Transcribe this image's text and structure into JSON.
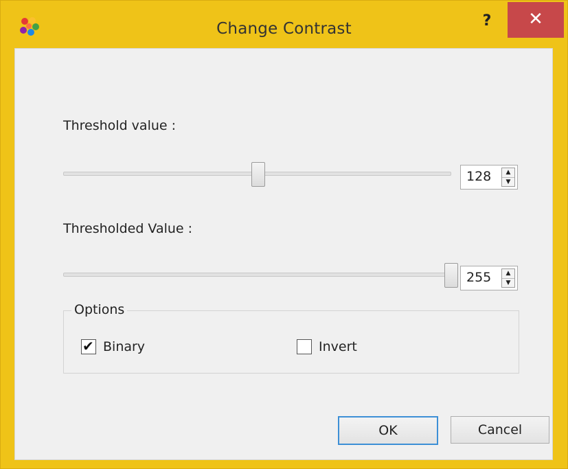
{
  "window": {
    "title": "Change Contrast",
    "help_label": "?",
    "close_label": "✕",
    "app_icon": "colored-dots-icon"
  },
  "threshold": {
    "label": "Threshold value :",
    "value": "128",
    "slider_fraction": 0.502,
    "max": 255
  },
  "thresholded": {
    "label": "Thresholded Value :",
    "value": "255",
    "slider_fraction": 1.0,
    "max": 255
  },
  "options": {
    "title": "Options",
    "binary": {
      "label": "Binary",
      "checked": true
    },
    "invert": {
      "label": "Invert",
      "checked": false
    }
  },
  "buttons": {
    "ok": "OK",
    "cancel": "Cancel"
  },
  "colors": {
    "frame": "#efc318",
    "close": "#c7484a",
    "default_button_border": "#3c8fd6"
  }
}
